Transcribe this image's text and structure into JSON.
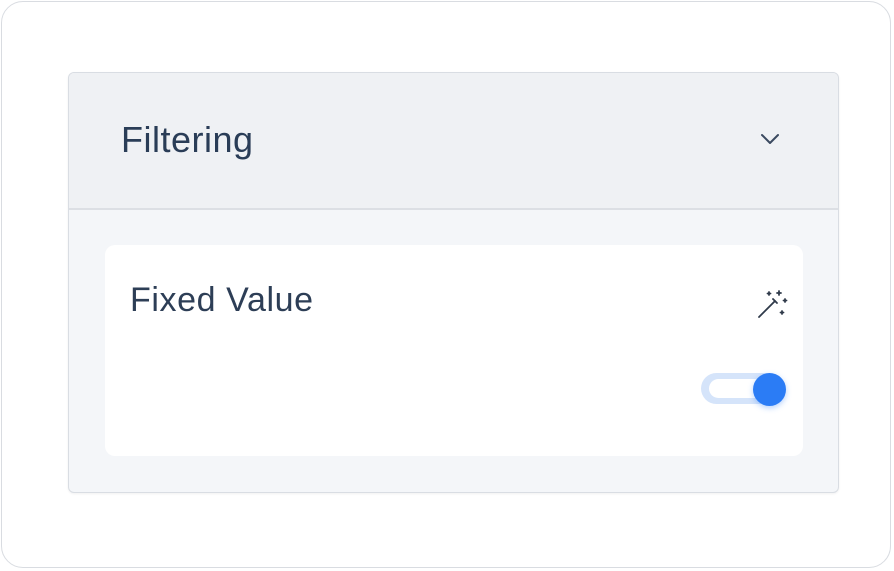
{
  "section": {
    "title": "Filtering",
    "expanded": true,
    "expand_icon": "chevron-down-icon"
  },
  "field": {
    "label": "Fixed Value",
    "action_icon": "magic-wand-icon",
    "toggle_on": true
  },
  "colors": {
    "accent": "#2b7cf5",
    "track": "#d5e4fa",
    "text": "#2a3d57",
    "header_bg": "#eff1f4",
    "panel_bg": "#f4f6f9"
  }
}
